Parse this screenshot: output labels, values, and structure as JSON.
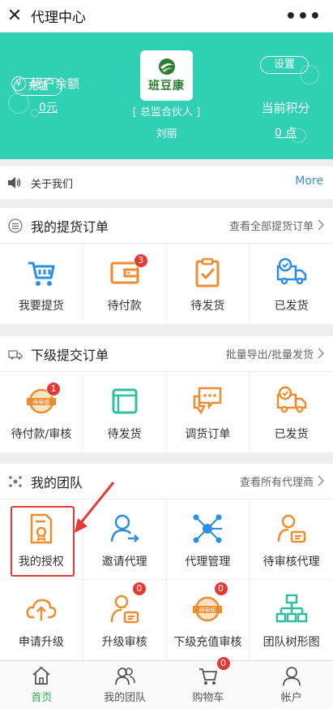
{
  "titlebar": {
    "close_icon": "close-icon",
    "title": "代理中心",
    "menu_icon": "more-dots-icon"
  },
  "header": {
    "balance_label": "帐户余额",
    "balance_value": "0元",
    "recharge_label": "充值",
    "logo_text": "班豆康",
    "role": "[ 总监合伙人 ]",
    "user_name": "刘丽",
    "settings_label": "设置",
    "points_label": "当前积分",
    "points_value": "0 点",
    "bg_color": "#2fd0b4"
  },
  "notice": {
    "icon": "speaker-icon",
    "text": "关于我们",
    "more": "More"
  },
  "pickup_orders": {
    "title": "我的提货订单",
    "link": "查看全部提货订单",
    "items": [
      {
        "label": "我要提货",
        "icon": "cart-icon",
        "badge": ""
      },
      {
        "label": "待付款",
        "icon": "wallet-icon",
        "badge": "3"
      },
      {
        "label": "待发货",
        "icon": "clipboard-check-icon",
        "badge": ""
      },
      {
        "label": "已发货",
        "icon": "truck-icon",
        "badge": ""
      }
    ]
  },
  "sub_orders": {
    "title": "下级提交订单",
    "link": "批量导出/批量发货",
    "items": [
      {
        "label": "待付款/审核",
        "icon": "pending-stamp-icon",
        "badge": "1"
      },
      {
        "label": "待发货",
        "icon": "stack-icon",
        "badge": ""
      },
      {
        "label": "调货订单",
        "icon": "chat-icon",
        "badge": ""
      },
      {
        "label": "已发货",
        "icon": "truck-icon",
        "badge": ""
      }
    ]
  },
  "team": {
    "title": "我的团队",
    "link": "查看所有代理商",
    "items": [
      {
        "label": "我的授权",
        "icon": "certificate-icon",
        "badge": ""
      },
      {
        "label": "邀请代理",
        "icon": "invite-user-icon",
        "badge": ""
      },
      {
        "label": "代理管理",
        "icon": "network-icon",
        "badge": ""
      },
      {
        "label": "待审核代理",
        "icon": "user-card-icon",
        "badge": ""
      },
      {
        "label": "申请升级",
        "icon": "cloud-upload-icon",
        "badge": ""
      },
      {
        "label": "升级审核",
        "icon": "user-card-icon",
        "badge": "0"
      },
      {
        "label": "下级充值审核",
        "icon": "pending-stamp-icon",
        "badge": "0"
      },
      {
        "label": "团队树形图",
        "icon": "tree-icon",
        "badge": ""
      }
    ]
  },
  "tabbar": {
    "items": [
      {
        "label": "首页",
        "icon": "home-icon",
        "active": true
      },
      {
        "label": "我的团队",
        "icon": "team-icon"
      },
      {
        "label": "购物车",
        "icon": "cart-icon",
        "badge": "0"
      },
      {
        "label": "帐户",
        "icon": "user-icon"
      }
    ]
  },
  "colors": {
    "accent_orange": "#f08c2e",
    "accent_blue": "#3a8ee6",
    "active_green": "#2fae5a",
    "highlight_red": "#e53935"
  }
}
